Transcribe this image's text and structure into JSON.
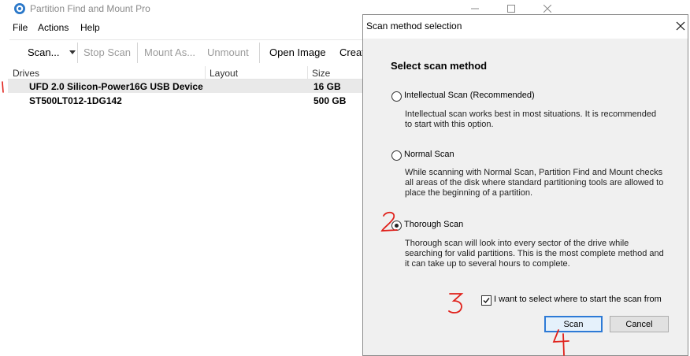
{
  "window": {
    "title": "Partition Find and Mount Pro",
    "icons": {
      "logo": "app-logo-icon",
      "minimize": "minimize-icon",
      "maximize": "maximize-icon",
      "close": "close-icon"
    }
  },
  "menu": [
    "File",
    "Actions",
    "Help"
  ],
  "toolbar": {
    "scan": "Scan...",
    "stop_scan": "Stop Scan",
    "mount_as": "Mount As...",
    "unmount": "Unmount",
    "open_image": "Open Image",
    "create": "Creat"
  },
  "drives_table": {
    "columns": [
      "Drives",
      "Layout",
      "Size"
    ],
    "rows": [
      {
        "drive": "UFD 2.0 Silicon-Power16G USB Device",
        "layout": "",
        "size": "16 GB"
      },
      {
        "drive": "ST500LT012-1DG142",
        "layout": "",
        "size": "500 GB"
      }
    ]
  },
  "dialog": {
    "title": "Scan method selection",
    "heading": "Select scan method",
    "options": [
      {
        "label": "Intellectual Scan (Recommended)",
        "selected": false,
        "description": "Intellectual scan works best in most situations. It is recommended to start with this option."
      },
      {
        "label": "Normal Scan",
        "selected": false,
        "description": "While scanning with Normal Scan, Partition Find and Mount checks all areas of the disk where standard partitioning tools are allowed to place the beginning of a partition."
      },
      {
        "label": "Thorough Scan",
        "selected": true,
        "description": "Thorough scan will look into every sector of the drive while searching for valid partitions. This is the most complete method and it can take up to several hours to complete."
      }
    ],
    "checkbox": {
      "label": "I want to select where to start the scan from",
      "checked": true
    },
    "buttons": {
      "scan": "Scan",
      "cancel": "Cancel"
    }
  },
  "annotations": {
    "color": "#e0201a",
    "marks": [
      "1",
      "2",
      "3",
      "4"
    ]
  },
  "colors": {
    "default_button_border": "#2d7ad6",
    "dialog_body": "#f0f0f0",
    "selected_row": "#e9e9e9"
  }
}
